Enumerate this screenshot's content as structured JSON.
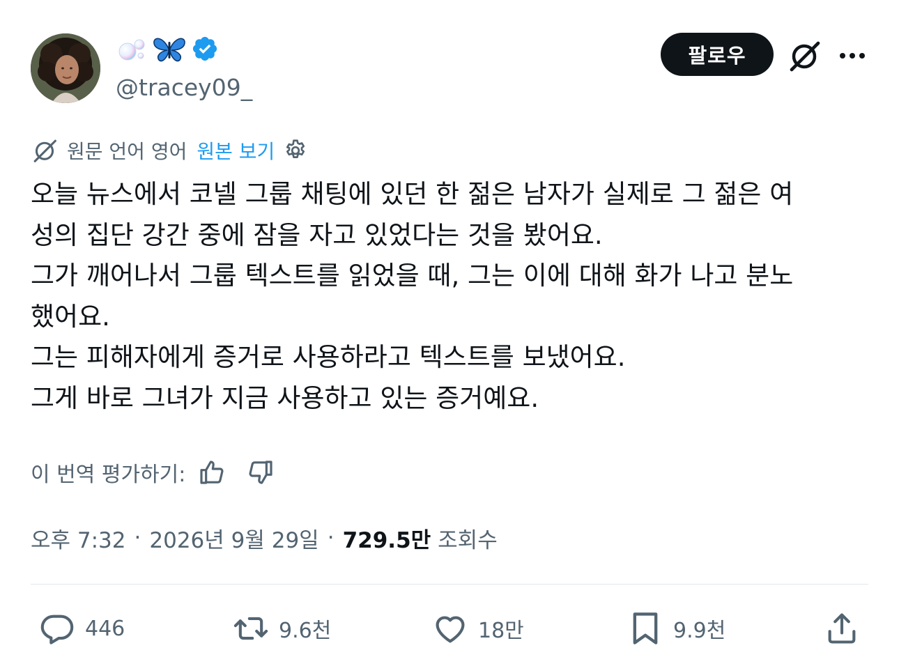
{
  "tweet": {
    "author": {
      "handle": "@tracey09_",
      "display_name_emojis": [
        "bubbles-emoji",
        "butterfly-emoji"
      ],
      "verified": true
    },
    "follow_label": "팔로우",
    "translation": {
      "source_lang_text": "원문 언어 영어",
      "view_original_label": "원본 보기"
    },
    "body_lines": [
      "오늘 뉴스에서 코넬 그룹 채팅에 있던 한 젊은 남자가 실제로 그 젊은 여",
      "성의 집단 강간 중에 잠을 자고 있었다는 것을 봤어요.",
      "그가 깨어나서 그룹 텍스트를 읽었을 때, 그는 이에 대해 화가 나고 분노",
      "했어요.",
      "그는 피해자에게 증거로 사용하라고 텍스트를 보냈어요.",
      "그게 바로 그녀가 지금 사용하고 있는 증거예요."
    ],
    "rate_translation_label": "이 번역 평가하기:",
    "meta": {
      "time": "오후 7:32",
      "separator": "·",
      "date": "2026년 9월 29일",
      "views_count": "729.5만",
      "views_label": "조회수"
    },
    "actions": {
      "reply_count": "446",
      "retweet_count": "9.6천",
      "like_count": "18만",
      "bookmark_count": "9.9천"
    }
  },
  "colors": {
    "text_primary": "#0f1419",
    "text_secondary": "#536471",
    "link_blue": "#1d9bf0",
    "verified_blue": "#1d9bf0",
    "divider": "#e1e8ed"
  },
  "icons": {
    "verified": "verified-badge-icon",
    "grok": "grok-icon",
    "more": "more-dots-icon",
    "gear": "gear-icon",
    "thumbs_up": "thumbs-up-icon",
    "thumbs_down": "thumbs-down-icon",
    "reply": "reply-icon",
    "retweet": "retweet-icon",
    "like": "heart-icon",
    "bookmark": "bookmark-icon",
    "share": "share-icon"
  }
}
